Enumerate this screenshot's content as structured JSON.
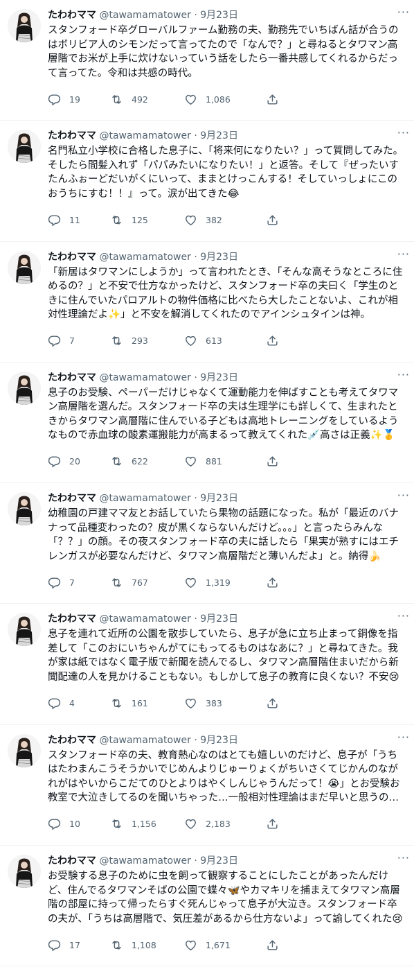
{
  "tweets": [
    {
      "name": "たわわママ",
      "handle": "@tawamamatower",
      "sep": "·",
      "date": "9月23日",
      "text": "スタンフォード卒グローバルファーム勤務の夫、勤務先でいちばん話が合うのはボリビア人のシモンだって言ってたので「なんで？」と尋ねるとタワマン高層階でお米が上手に炊けないっていう話をしたら一番共感してくれるからだって言ってた。令和は共感の時代。",
      "replies": "19",
      "retweets": "492",
      "likes": "1,086"
    },
    {
      "name": "たわわママ",
      "handle": "@tawamamatower",
      "sep": "·",
      "date": "9月23日",
      "text": "名門私立小学校に合格した息子に、「将来何になりたい？」って質問してみた。そしたら間髪入れず「パパみたいになりたい！」と返答。そして『ぜったいすたんふぉーどだいがくにいって、ままとけっこんする！そしていっしょにこのおうちにすむ！！』って。涙が出てきた😂",
      "replies": "11",
      "retweets": "125",
      "likes": "382"
    },
    {
      "name": "たわわママ",
      "handle": "@tawamamatower",
      "sep": "·",
      "date": "9月23日",
      "text": "「新居はタワマンにしようか」って言われたとき、「そんな高そうなところに住めるの？」と不安で仕方なかったけど、スタンフォード卒の夫曰く「学生のときに住んでいたパロアルトの物件価格に比べたら大したことないよ、これが相対性理論だよ✨」と不安を解消してくれたのでアインシュタインは神。",
      "replies": "7",
      "retweets": "293",
      "likes": "613"
    },
    {
      "name": "たわわママ",
      "handle": "@tawamamatower",
      "sep": "·",
      "date": "9月23日",
      "text": "息子のお受験、ペーパーだけじゃなくて運動能力を伸ばすことも考えてタワマン高層階を選んだ。スタンフォード卒の夫は生理学にも詳しくて、生まれたときからタワマン高層階に住んでいる子どもは高地トレーニングをしているようなもので赤血球の酸素運搬能力が高まるって教えてくれた💉高さは正義✨🥇",
      "replies": "20",
      "retweets": "622",
      "likes": "881"
    },
    {
      "name": "たわわママ",
      "handle": "@tawamamatower",
      "sep": "·",
      "date": "9月23日",
      "text": "幼稚園の戸建ママ友とお話していたら果物の話題になった。私が「最近のバナナって品種変わったの？皮が黒くならないんだけど。。。」と言ったらみんな「？？」の顔。その夜スタンフォード卒の夫に話したら「果実が熟すにはエチレンガスが必要なんだけど、タワマン高層階だと薄いんだよ」と。納得🍌",
      "replies": "7",
      "retweets": "767",
      "likes": "1,319"
    },
    {
      "name": "たわわママ",
      "handle": "@tawamamatower",
      "sep": "·",
      "date": "9月23日",
      "text": "息子を連れて近所の公園を散歩していたら、息子が急に立ち止まって銅像を指差して「このおにいちゃんがてにもってるものはなあに？」と尋ねてきた。我が家は紙ではなく電子版で新聞を読んでるし、タワマン高層階住まいだから新聞配達の人を見かけることもない。もしかして息子の教育に良くない？不安😢",
      "replies": "4",
      "retweets": "161",
      "likes": "383"
    },
    {
      "name": "たわわママ",
      "handle": "@tawamamatower",
      "sep": "·",
      "date": "9月23日",
      "text": "スタンフォード卒の夫、教育熱心なのはとても嬉しいのだけど、息子が「うちはたわまんこうそうかいでじめんよりじゅーりょくがちいさくてじかんのながれがはやいからこだてのひとよりはやくしんじゃうんだって！😭」とお受験お教室で大泣きしてるのを聞いちゃった…一般相対性理論はまだ早いと思うの…",
      "replies": "10",
      "retweets": "1,156",
      "likes": "2,183"
    },
    {
      "name": "たわわママ",
      "handle": "@tawamamatower",
      "sep": "·",
      "date": "9月23日",
      "text": "お受験する息子のために虫を飼って観察することにしたことがあったんだけど、住んでるタワマンそばの公園で蝶々🦋やカマキリを捕まえてタワマン高層階の部屋に持って帰ったらすぐ死んじゃって息子が大泣き。スタンフォード卒の夫が、「うちは高層階で、気圧差があるから仕方ないよ」って諭してくれた😢",
      "replies": "17",
      "retweets": "1,108",
      "likes": "1,671"
    }
  ],
  "icons": {
    "reply": "reply-icon",
    "retweet": "retweet-icon",
    "like": "heart-icon",
    "share": "share-icon",
    "more": "more-icon"
  },
  "colors": {
    "text": "#0f1419",
    "secondary": "#536471",
    "divider": "#eff3f4"
  }
}
